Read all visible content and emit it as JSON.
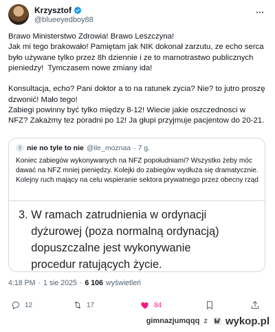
{
  "tweet": {
    "author": {
      "name": "Krzysztof",
      "handle": "@blueeyedboy88"
    },
    "text": "Brawo Ministerstwo Zdrowia! Brawo Leszczyna!\nJak mi tego brakowało! Pamiętam jak NIK dokonał zarzutu, ze echo serca było używane tylko przez 8h dziennie i ze to marnotrastwo publicznych pieniedzy!  Tymczasem nowe zmiany ida!\n\nKonsultacja, echo? Pani doktor a to na ratunek zycia? Nie? to jutro proszę dzwonić! Mało tego!\nZabiegi powinny być tylko między 8-12! Wiecie jakie oszczednosci w NFZ? Zakażmy tez poradni po 12! Ja głupi przyjmuje pacjentow do 20-21.",
    "quote": {
      "name": "nie no tyle to nie",
      "handle": "@ile_moznaa",
      "time": "· 7 g.",
      "text": "Koniec zabiegów wykonywanych na NFZ popołudniami? Wszystko żeby móc dawać na NFZ mniej pieniędzy. Kolejki do zabiegów wydłuża się dramatycznie. Kolejny ruch mający na celu wspieranie sektora prywatnego przez obecny rząd",
      "image_text": "3. W ramach zatrudnienia w ordynacji\n    dyżurowej (poza normalną ordynacją)\n    dopuszczalne jest wykonywanie\n    procedur ratujących życie."
    },
    "meta": {
      "time": "4:18 PM",
      "dot": "·",
      "date": "1 sie 2025",
      "views_count": "6 106",
      "views_label": "wyświetleń"
    },
    "actions": {
      "replies": "12",
      "retweets": "17",
      "likes": "84"
    }
  },
  "footer": {
    "username": "gimnazjumqqq",
    "sep": "z",
    "brand": "wykop.pl"
  },
  "colors": {
    "like": "#f91880",
    "verified": "#1d9bf0",
    "muted": "#536471"
  }
}
